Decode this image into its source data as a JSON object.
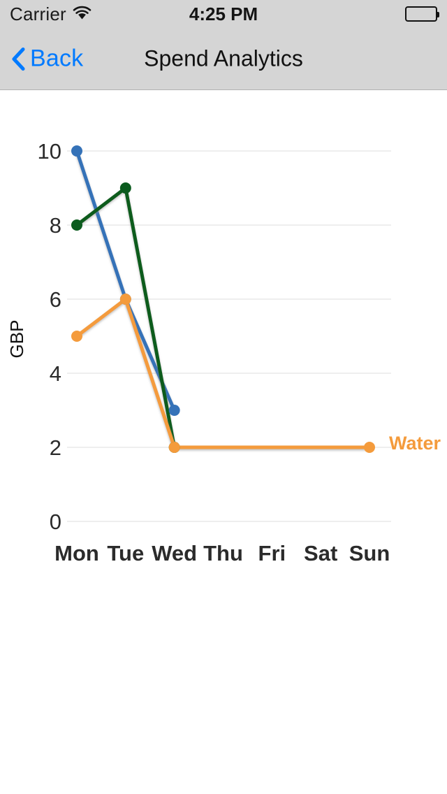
{
  "status_bar": {
    "carrier": "Carrier",
    "wifi_icon": "wifi-icon",
    "time": "4:25 PM",
    "battery_icon": "battery-full-icon"
  },
  "nav_bar": {
    "back_label": "Back",
    "back_icon": "chevron-left-icon",
    "title": "Spend Analytics"
  },
  "colors": {
    "accent_blue": "#007aff",
    "series_blue": "#3572b8",
    "series_green": "#0b5b1e",
    "series_orange": "#f49b3c",
    "gridline": "#eeeeee",
    "status_bar_bg": "#d5d5d5",
    "nav_bar_bg": "#d5d5d5"
  },
  "chart_data": {
    "type": "line",
    "title": "",
    "xlabel": "",
    "ylabel": "GBP",
    "categories": [
      "Mon",
      "Tue",
      "Wed",
      "Thu",
      "Fri",
      "Sat",
      "Sun"
    ],
    "ylim": [
      0,
      10
    ],
    "yticks": [
      0,
      2,
      4,
      6,
      8,
      10
    ],
    "ytick_labels": [
      "0",
      "2",
      "4",
      "6",
      "8",
      "10"
    ],
    "grid": true,
    "legend_position": "right-inline",
    "series": [
      {
        "name": "",
        "color": "#3572b8",
        "x": [
          "Mon",
          "Tue",
          "Wed"
        ],
        "values": [
          10,
          6,
          3
        ],
        "label": ""
      },
      {
        "name": "",
        "color": "#0b5b1e",
        "x": [
          "Mon",
          "Tue",
          "Wed"
        ],
        "values": [
          8,
          9,
          2
        ],
        "label": ""
      },
      {
        "name": "Water",
        "color": "#f49b3c",
        "x": [
          "Mon",
          "Tue",
          "Wed",
          "Sun"
        ],
        "values": [
          5,
          6,
          2,
          2
        ],
        "label": "Water"
      }
    ],
    "annotations": [
      {
        "text": "Water",
        "color": "#f49b3c",
        "at_x": "Sun",
        "at_y": 2
      }
    ]
  }
}
